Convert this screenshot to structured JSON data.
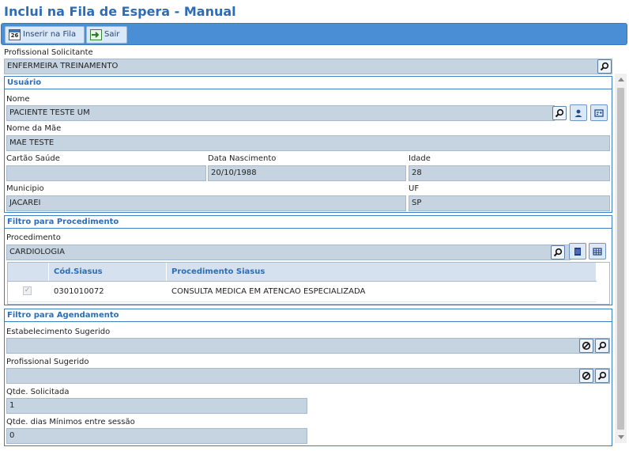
{
  "page": {
    "title": "Inclui na Fila de Espera - Manual"
  },
  "toolbar": {
    "insert_label": "Inserir na Fila",
    "insert_icon_text": "26",
    "exit_label": "Sair"
  },
  "profissional": {
    "label": "Profissional Solicitante",
    "value": "ENFERMEIRA TREINAMENTO"
  },
  "usuario": {
    "heading": "Usuário",
    "nome_label": "Nome",
    "nome_value": "PACIENTE TESTE UM",
    "mae_label": "Nome da Mãe",
    "mae_value": "MAE TESTE",
    "cartao_label": "Cartão Saúde",
    "cartao_value": "",
    "nasc_label": "Data Nascimento",
    "nasc_value": "20/10/1988",
    "idade_label": "Idade",
    "idade_value": "28",
    "municipio_label": "Municipio",
    "municipio_value": "JACAREI",
    "uf_label": "UF",
    "uf_value": "SP"
  },
  "procedimento": {
    "heading": "Filtro para Procedimento",
    "label": "Procedimento",
    "value": "CARDIOLOGIA",
    "grid": {
      "columns": [
        "Cód.Siasus",
        "Procedimento Siasus"
      ],
      "rows": [
        {
          "checked": true,
          "codigo": "0301010072",
          "descricao": "CONSULTA MEDICA EM ATENCAO ESPECIALIZADA"
        }
      ]
    }
  },
  "agendamento": {
    "heading": "Filtro para Agendamento",
    "estab_label": "Estabelecimento Sugerido",
    "estab_value": "",
    "prof_label": "Profissional Sugerido",
    "prof_value": "",
    "qtde_label": "Qtde. Solicitada",
    "qtde_value": "1",
    "dias_label": "Qtde. dias Mínimos entre sessão",
    "dias_value": "0"
  },
  "colors": {
    "accent": "#2e6db4",
    "toolbar": "#4a8fd6",
    "field_bg": "#c6d4e2"
  },
  "icons": {
    "search": "search-icon",
    "clear": "clear-icon",
    "person": "person-icon",
    "card": "card-icon",
    "list": "list-icon",
    "grid": "table-icon"
  }
}
